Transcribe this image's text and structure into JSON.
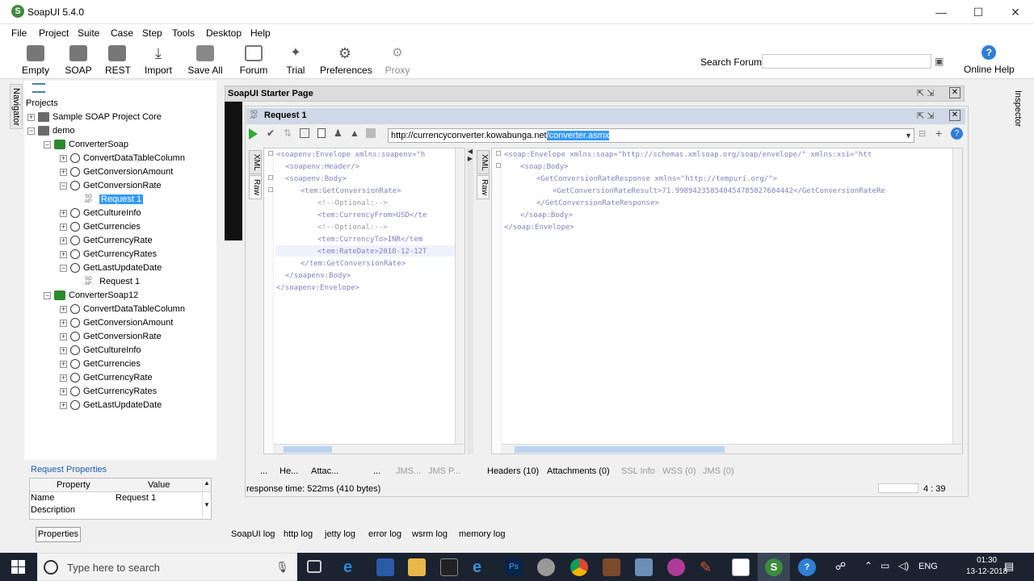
{
  "window": {
    "title": "SoapUI 5.4.0",
    "minimize": "—",
    "maximize": "☐",
    "close": "✕"
  },
  "menu": [
    "File",
    "Project",
    "Suite",
    "Case",
    "Step",
    "Tools",
    "Desktop",
    "Help"
  ],
  "toolbar": {
    "buttons": [
      {
        "label": "Empty",
        "icon": "empty-project-icon"
      },
      {
        "label": "SOAP",
        "icon": "soap-icon"
      },
      {
        "label": "REST",
        "icon": "rest-icon"
      },
      {
        "label": "Import",
        "icon": "import-icon"
      },
      {
        "label": "Save All",
        "icon": "save-all-icon"
      },
      {
        "label": "Forum",
        "icon": "forum-icon"
      },
      {
        "label": "Trial",
        "icon": "trial-icon"
      },
      {
        "label": "Preferences",
        "icon": "gear-icon"
      },
      {
        "label": "Proxy",
        "icon": "proxy-icon"
      }
    ],
    "search_forum_label": "Search Forum",
    "search_forum_value": "",
    "online_help_label": "Online Help"
  },
  "side_tabs": {
    "navigator": "Navigator",
    "inspector": "Inspector"
  },
  "navigator": {
    "projects_label": "Projects",
    "tree": [
      {
        "label": "Sample SOAP Project Core",
        "level": 0,
        "kind": "folder",
        "exp": "+"
      },
      {
        "label": "demo",
        "level": 0,
        "kind": "folder",
        "exp": "−"
      },
      {
        "label": "ConverterSoap",
        "level": 1,
        "kind": "iface",
        "exp": "−"
      },
      {
        "label": "ConvertDataTableColumn",
        "level": 2,
        "kind": "op",
        "exp": "+"
      },
      {
        "label": "GetConversionAmount",
        "level": 2,
        "kind": "op",
        "exp": "+"
      },
      {
        "label": "GetConversionRate",
        "level": 2,
        "kind": "op",
        "exp": "−"
      },
      {
        "label": "Request 1",
        "level": 3,
        "kind": "req",
        "exp": "",
        "selected": true
      },
      {
        "label": "GetCultureInfo",
        "level": 2,
        "kind": "op",
        "exp": "+"
      },
      {
        "label": "GetCurrencies",
        "level": 2,
        "kind": "op",
        "exp": "+"
      },
      {
        "label": "GetCurrencyRate",
        "level": 2,
        "kind": "op",
        "exp": "+"
      },
      {
        "label": "GetCurrencyRates",
        "level": 2,
        "kind": "op",
        "exp": "+"
      },
      {
        "label": "GetLastUpdateDate",
        "level": 2,
        "kind": "op",
        "exp": "−"
      },
      {
        "label": "Request 1",
        "level": 3,
        "kind": "req",
        "exp": ""
      },
      {
        "label": "ConverterSoap12",
        "level": 1,
        "kind": "iface",
        "exp": "−"
      },
      {
        "label": "ConvertDataTableColumn",
        "level": 2,
        "kind": "op",
        "exp": "+"
      },
      {
        "label": "GetConversionAmount",
        "level": 2,
        "kind": "op",
        "exp": "+"
      },
      {
        "label": "GetConversionRate",
        "level": 2,
        "kind": "op",
        "exp": "+"
      },
      {
        "label": "GetCultureInfo",
        "level": 2,
        "kind": "op",
        "exp": "+"
      },
      {
        "label": "GetCurrencies",
        "level": 2,
        "kind": "op",
        "exp": "+"
      },
      {
        "label": "GetCurrencyRate",
        "level": 2,
        "kind": "op",
        "exp": "+"
      },
      {
        "label": "GetCurrencyRates",
        "level": 2,
        "kind": "op",
        "exp": "+"
      },
      {
        "label": "GetLastUpdateDate",
        "level": 2,
        "kind": "op",
        "exp": "+"
      }
    ]
  },
  "request_properties": {
    "title": "Request Properties",
    "headers": [
      "Property",
      "Value"
    ],
    "rows": [
      [
        "Name",
        "Request 1"
      ],
      [
        "Description",
        ""
      ]
    ],
    "button": "Properties"
  },
  "starter_page": {
    "title": "SoapUI Starter Page"
  },
  "request": {
    "title": "Request 1",
    "url_prefix": "http://currencyconverter.kowabunga.net",
    "url_selected": "/converter.asmx",
    "request_tabs": {
      "xml": "XML",
      "raw": "Raw"
    },
    "request_lines": [
      "<soapenv:Envelope xmlns:soapenv=\"h",
      "<soapenv:Header/>",
      "<soapenv:Body>",
      "<tem:GetConversionRate>",
      "<!--Optional:-->",
      "<tem:CurrencyFrom>USD</te",
      "<!--Optional:-->",
      "<tem:CurrencyTo>INR</tem",
      "<tem:RateDate>2018-12-12T",
      "</tem:GetConversionRate>",
      "</soapenv:Body>",
      "</soapenv:Envelope>"
    ],
    "response_lines": [
      "<soap:Envelope xmlns:soap=\"http://schemas.xmlsoap.org/soap/envelope/\" xmlns:xsi=\"htt",
      "<soap:Body>",
      "<GetConversionRateResponse xmlns=\"http://tempuri.org/\">",
      "<GetConversionRateResult>71.998942358540454785827604442</GetConversionRateRe",
      "</GetConversionRateResponse>",
      "</soap:Body>",
      "</soap:Envelope>"
    ],
    "req_bottom_tabs": [
      "...",
      "He...",
      "Attac...",
      "...",
      "JMS...",
      "JMS P..."
    ],
    "resp_bottom_tabs": [
      "Headers (10)",
      "Attachments (0)",
      "SSL Info",
      "WSS (0)",
      "JMS (0)"
    ],
    "status": "response time: 522ms (410 bytes)",
    "cursor_position": "4 : 39"
  },
  "logs": [
    "SoapUI log",
    "http log",
    "jetty log",
    "error log",
    "wsrm log",
    "memory log"
  ],
  "taskbar": {
    "search_placeholder": "Type here to search",
    "language": "ENG",
    "time": "01:30",
    "date": "13-12-2018"
  }
}
